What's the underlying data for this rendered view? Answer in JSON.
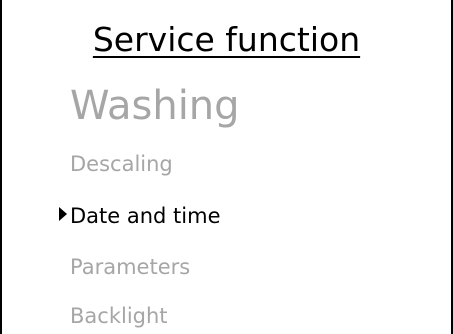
{
  "screen": {
    "title": "Service function",
    "menu_items": [
      {
        "label": "Washing",
        "state": "dimmed"
      },
      {
        "label": "Descaling",
        "state": "dimmed"
      },
      {
        "label": "Date and time",
        "state": "selected"
      },
      {
        "label": "Parameters",
        "state": "dimmed"
      },
      {
        "label": "Backlight",
        "state": "dimmed"
      }
    ],
    "colors": {
      "text": "#000000",
      "dimmed_text": "#a6a6a6",
      "background": "#ffffff"
    },
    "icons": {
      "selection_cursor": "triangle-right-icon"
    }
  }
}
